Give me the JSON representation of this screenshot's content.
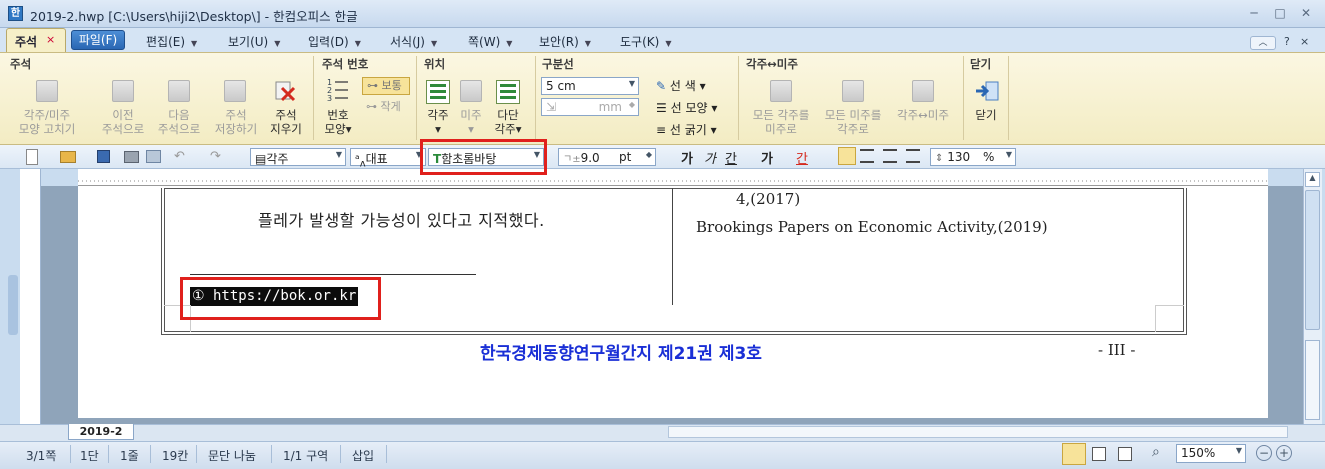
{
  "window": {
    "title": "2019-2.hwp [C:\\Users\\hiji2\\Desktop\\] - 한컴오피스 한글",
    "minimize": "─",
    "restore": "□",
    "close": "✕"
  },
  "tabs": {
    "active_label": "주석",
    "close_glyph": "×",
    "file_label": "파일(F)",
    "menus": [
      "편집(E)",
      "보기(U)",
      "입력(D)",
      "서식(J)",
      "쪽(W)",
      "보안(R)",
      "도구(K)"
    ],
    "help_up": "︿",
    "help_q": "?",
    "help_x": "×"
  },
  "ribbon": {
    "groups": {
      "annotation": "주석",
      "annotation_number": "주석 번호",
      "position": "위치",
      "separator": "구분선",
      "convert": "각주↔미주",
      "close": "닫기"
    },
    "annotation_buttons": [
      {
        "line1": "각주/미주",
        "line2": "모양 고치기"
      },
      {
        "line1": "이전",
        "line2": "주석으로"
      },
      {
        "line1": "다음",
        "line2": "주석으로"
      },
      {
        "line1": "주석",
        "line2": "저장하기"
      },
      {
        "line1": "주석",
        "line2": "지우기"
      }
    ],
    "number_buttons": {
      "shape_line1": "번호",
      "shape_line2": "모양▾",
      "normal": "보통",
      "small": "작게"
    },
    "position_buttons": [
      {
        "line1": "각주",
        "line2": "▾"
      },
      {
        "line1": "미주",
        "line2": "▾"
      },
      {
        "line1": "다단",
        "line2": "각주▾"
      }
    ],
    "separator": {
      "length_value": "5 cm",
      "offset_placeholder": "mm",
      "color_label": "선 색 ▾",
      "shape_label": "선 모양 ▾",
      "thickness_label": "선 굵기 ▾"
    },
    "convert_buttons": [
      {
        "line1": "모든 각주를",
        "line2": "미주로"
      },
      {
        "line1": "모든 미주를",
        "line2": "각주로"
      },
      {
        "line1": "각주↔미주",
        "line2": ""
      }
    ],
    "close_button": "닫기"
  },
  "toolbar": {
    "style": "각주",
    "lang": "대표",
    "font": "함초롬바탕",
    "size_value": "9.0",
    "size_unit": "pt",
    "bold": "가",
    "italic": "가",
    "underline": "간",
    "strike": "가",
    "color": "간",
    "line_spacing": "130",
    "line_spacing_unit": "%"
  },
  "document": {
    "top_cut_text": "……………………………………",
    "left_para": "플레가 발생할 가능성이 있다고 지적했다.",
    "footnote": "① https://bok.or.kr",
    "right_line1": "4,(2017)",
    "right_line2": "Brookings Papers on Economic Activity,(2019)",
    "footer_title": "한국경제동향연구월간지 제21권 제3호",
    "page_label": "- III -"
  },
  "sheet_tab": "2019-2",
  "status": {
    "page": "3/1쪽",
    "column": "1단",
    "line": "1줄",
    "char": "19칸",
    "break": "문단 나눔",
    "section": "1/1 구역",
    "mode": "삽입",
    "zoom": "150%"
  },
  "colors": {
    "accent": "#2a67b3",
    "highlight": "#e0201c",
    "footer_blue": "#1a2fd6",
    "ribbon_bg": "#f6efc8"
  }
}
